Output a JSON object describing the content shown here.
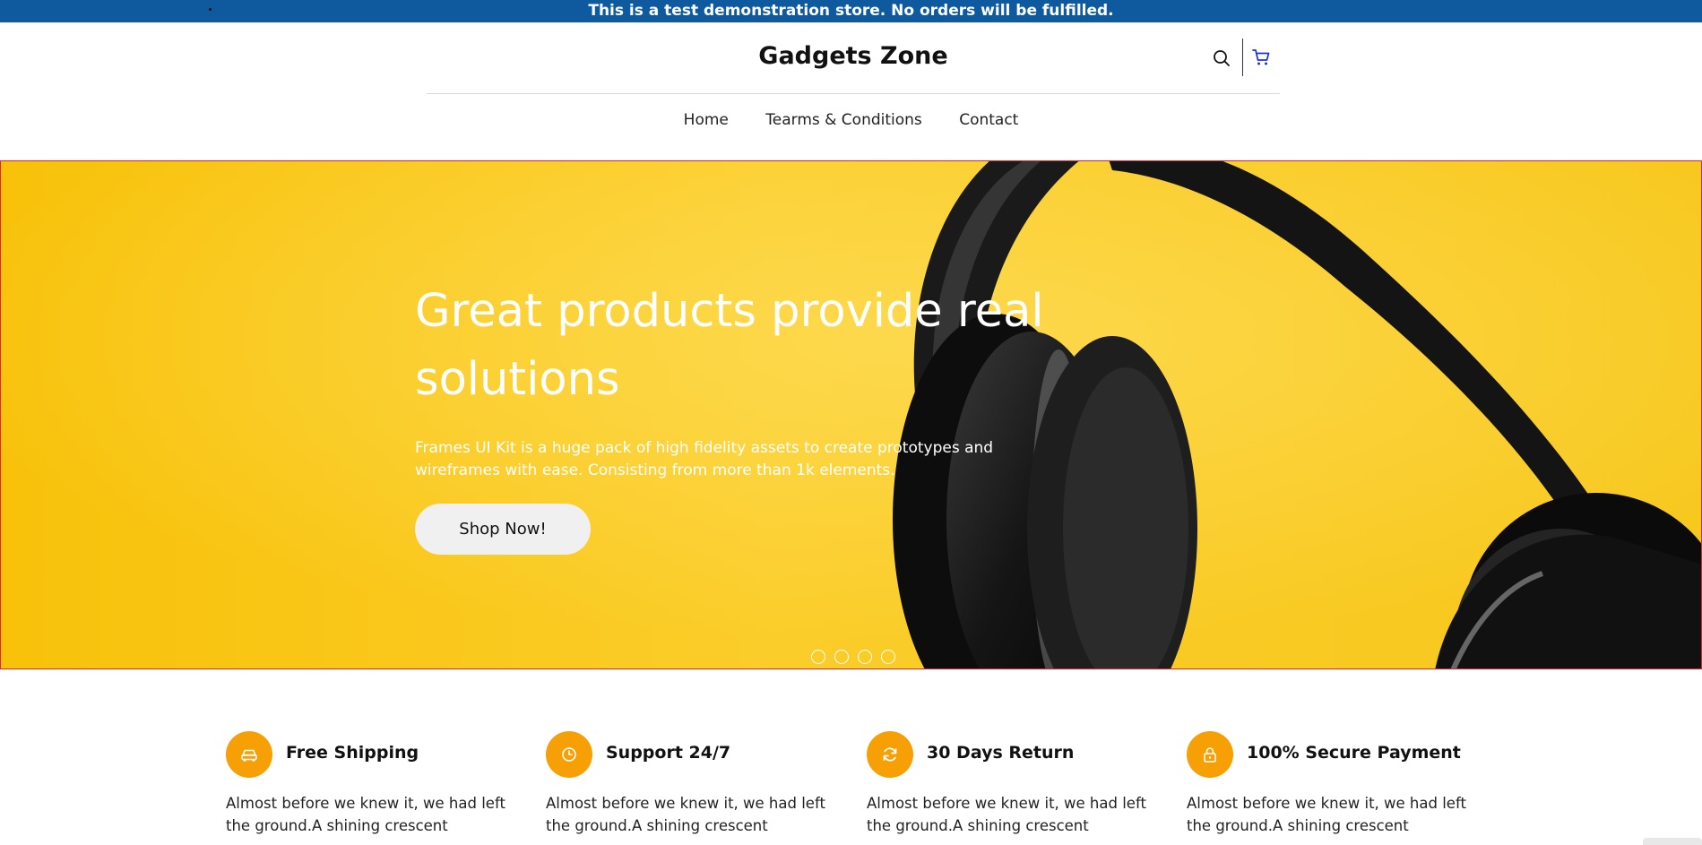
{
  "announcement": {
    "text": "This is a test demonstration store. No orders will be fulfilled."
  },
  "header": {
    "brand": "Gadgets Zone",
    "icons": {
      "search": "search-icon",
      "cart": "cart-icon"
    },
    "cart_color": "#1f33c9"
  },
  "nav": {
    "items": [
      {
        "label": "Home"
      },
      {
        "label": "Tearms & Conditions"
      },
      {
        "label": "Contact"
      }
    ]
  },
  "hero": {
    "title": "Great products provide real solutions",
    "subtitle": "Frames UI Kit is a huge pack of high fidelity assets to create prototypes and wireframes with ease. Consisting from more than 1k elements.",
    "cta_label": "Shop Now!",
    "background_color": "#f9c413",
    "slide_count": 4
  },
  "features": [
    {
      "icon": "car-icon",
      "title": "Free Shipping",
      "text": "Almost before we knew it, we had left the ground.A shining crescent"
    },
    {
      "icon": "clock-icon",
      "title": "Support 24/7",
      "text": "Almost before we knew it, we had left the ground.A shining crescent"
    },
    {
      "icon": "refresh-icon",
      "title": "30 Days Return",
      "text": "Almost before we knew it, we had left the ground.A shining crescent"
    },
    {
      "icon": "lock-icon",
      "title": "100% Secure Payment",
      "text": "Almost before we knew it, we had left the ground.A shining crescent"
    }
  ],
  "colors": {
    "announcement_bg": "#0f5a9e",
    "accent": "#f6a006"
  }
}
